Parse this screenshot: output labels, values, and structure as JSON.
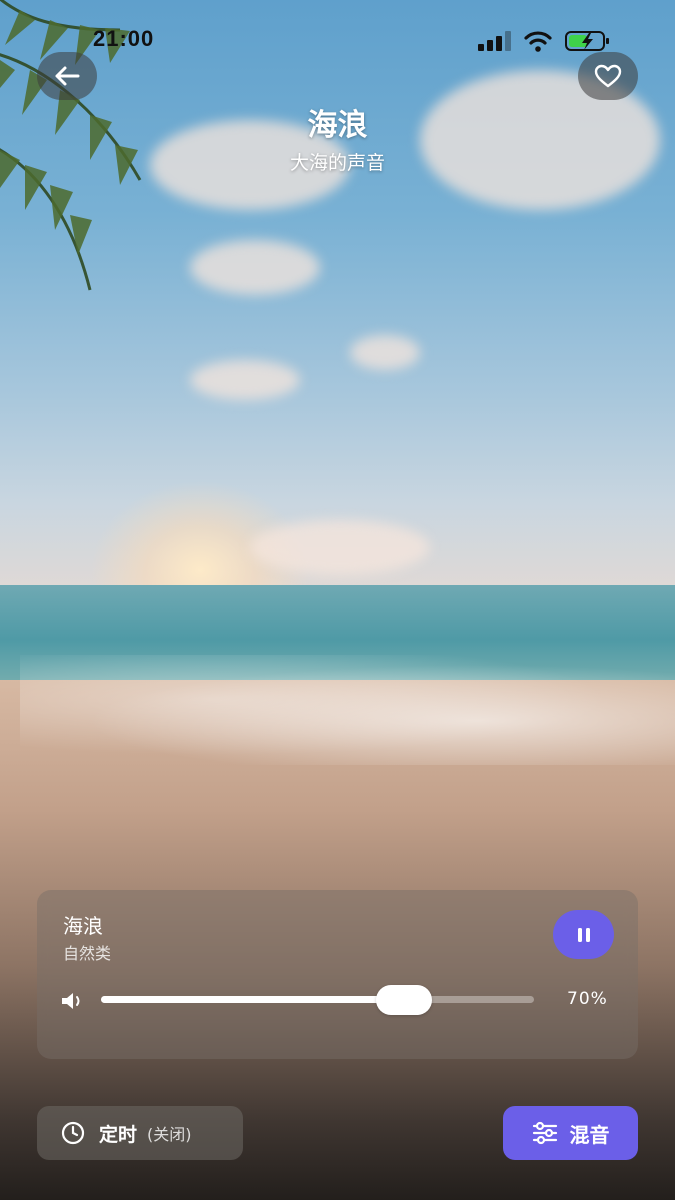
{
  "status_bar": {
    "time": "21:00"
  },
  "header": {
    "title": "海浪",
    "subtitle": "大海的声音",
    "back_icon": "arrow-left-icon",
    "favorite_icon": "heart-icon"
  },
  "player": {
    "track_name": "海浪",
    "category": "自然类",
    "state": "playing",
    "pause_icon": "pause-icon",
    "volume_icon": "speaker-icon",
    "volume_fraction": 0.7,
    "volume_label": "70%"
  },
  "timer": {
    "icon": "clock-icon",
    "label": "定时",
    "state": "(关闭)"
  },
  "mix": {
    "icon": "sliders-icon",
    "label": "混音"
  },
  "colors": {
    "accent": "#6b5fe8"
  }
}
